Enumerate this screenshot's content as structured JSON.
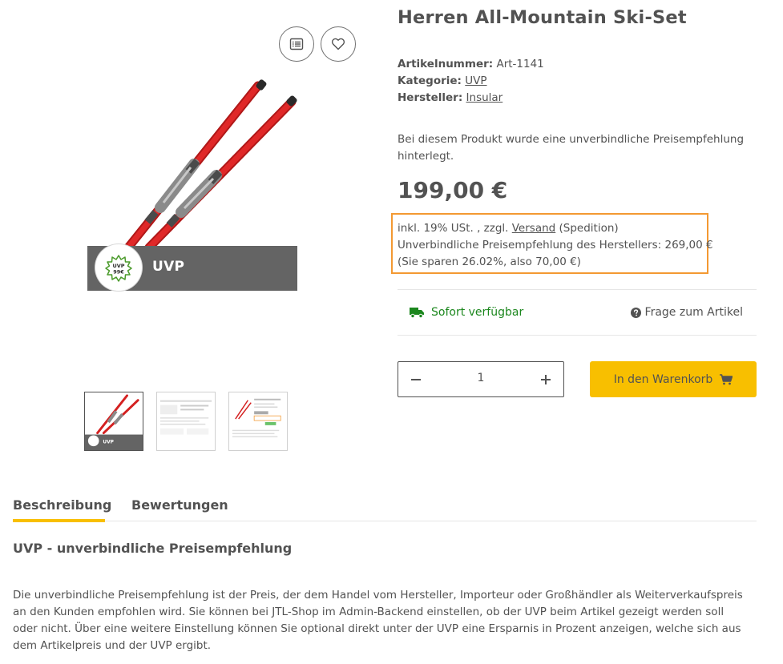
{
  "gallery": {
    "compare_icon": "list-icon",
    "wishlist_icon": "heart-icon",
    "uvp_label": "UVP",
    "badge_line1": "UVP",
    "badge_line2": "99€",
    "thumb_label": "UVP"
  },
  "product": {
    "title": "Herren All-Mountain Ski-Set",
    "sku_label": "Artikelnummer:",
    "sku": "Art-1141",
    "category_label": "Kategorie:",
    "category": "UVP",
    "manufacturer_label": "Hersteller:",
    "manufacturer": "Insular",
    "hint": "Bei diesem Produkt wurde eine unverbindliche Preisempfehlung hinterlegt.",
    "price": "199,00 €"
  },
  "price_box": {
    "tax_prefix": "inkl. 19% USt. , zzgl. ",
    "shipping_link": "Versand",
    "shipping_suffix": " (Spedition)",
    "rrp_line": "Unverbindliche Preisempfehlung des Herstellers: 269,00 €",
    "savings_line": "(Sie sparen 26.02%, also 70,00 €)"
  },
  "availability": {
    "status": "Sofort verfügbar",
    "question": "Frage zum Artikel"
  },
  "cart": {
    "quantity": "1",
    "button": "In den Warenkorb"
  },
  "tabs": [
    "Beschreibung",
    "Bewertungen"
  ],
  "description": {
    "title": "UVP - unverbindliche Preisempfehlung",
    "text": "Die unverbindliche Preisempfehlung ist der Preis, der dem Handel vom Hersteller, Importeur oder Großhändler als Weiterverkaufspreis an den Kunden empfohlen wird. Sie können bei JTL-Shop im Admin-Backend einstellen, ob der UVP beim Artikel gezeigt werden soll oder nicht. Über eine weitere Einstellung können Sie optional direkt unter der UVP eine Ersparnis in Prozent anzeigen, welche sich aus dem Artikelpreis und der UVP ergibt."
  },
  "colors": {
    "accent": "#f8bf00",
    "highlight_border": "#f39932",
    "available": "#1c871e",
    "text": "#525252",
    "ski_red": "#d42020"
  }
}
